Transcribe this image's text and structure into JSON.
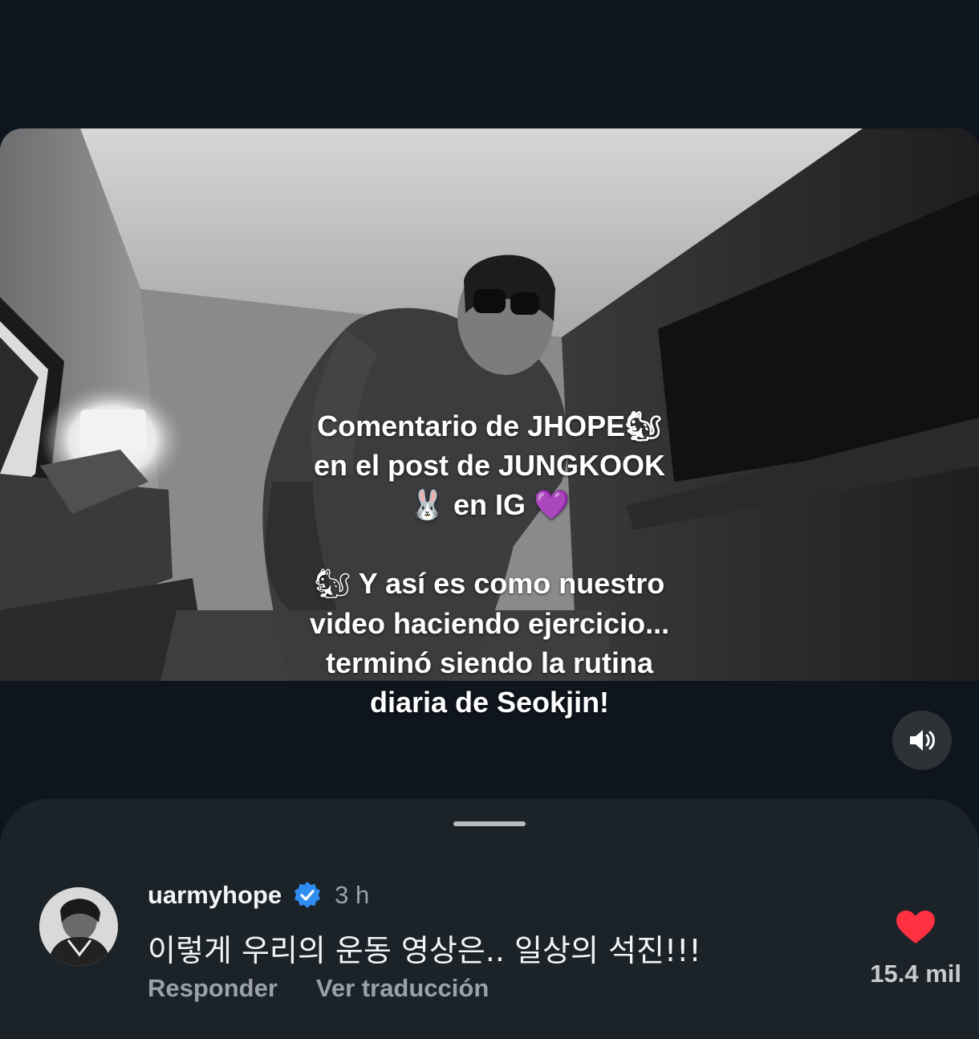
{
  "video": {
    "caption_line1": "Comentario de JHOPE🐿",
    "caption_line2": "en el post de JUNGKOOK",
    "caption_line3_emoji": "🐰",
    "caption_line3_text": " en IG ",
    "caption_line3_heart": "💜",
    "caption_line4_emoji": "🐿",
    "caption_line4_text": " Y así es como nuestro",
    "caption_line5": "video haciendo ejercicio...",
    "caption_line6": "terminó siendo la rutina",
    "caption_line7": "diaria de Seokjin!"
  },
  "controls": {
    "volume_icon": "volume-icon"
  },
  "comment": {
    "username": "uarmyhope",
    "verified_icon": "verified-badge-icon",
    "time": "3 h",
    "text": "이렇게 우리의 운동 영상은.. 일상의 석진!!!",
    "reply_label": "Responder",
    "translate_label": "Ver traducción",
    "like_icon": "heart-icon",
    "like_count": "15.4 mil"
  },
  "colors": {
    "background": "#0f151c",
    "sheet": "#1c2328",
    "verified_blue": "#2f8cf0",
    "heart_red": "#ff3040",
    "muted_text": "#9aa2a8"
  }
}
